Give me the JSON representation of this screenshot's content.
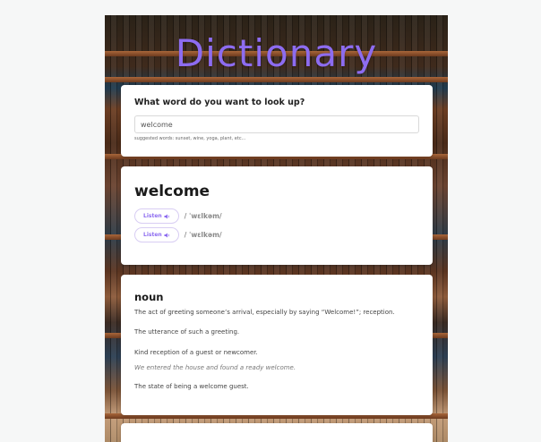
{
  "app": {
    "title": "Dictionary",
    "accent_color": "#8d6cf0"
  },
  "search": {
    "question": "What word do you want to look up?",
    "value": "welcome",
    "suggested": "suggested words: sunset, wine, yoga, plant, etc..."
  },
  "entry": {
    "word": "welcome",
    "phonetics": [
      {
        "listen_label": "Listen",
        "icon": "speaker-icon",
        "text": "/ ˈwɛlkəm/"
      },
      {
        "listen_label": "Listen",
        "icon": "speaker-icon",
        "text": "/ ˈwɛlkəm/"
      }
    ]
  },
  "meaning": {
    "part_of_speech": "noun",
    "definitions": [
      "The act of greeting someone’s arrival, especially by saying “Welcome!”; reception.",
      "The utterance of such a greeting.",
      "Kind reception of a guest or newcomer.",
      "The state of being a welcome guest."
    ],
    "example": "We entered the house and found a ready welcome."
  }
}
